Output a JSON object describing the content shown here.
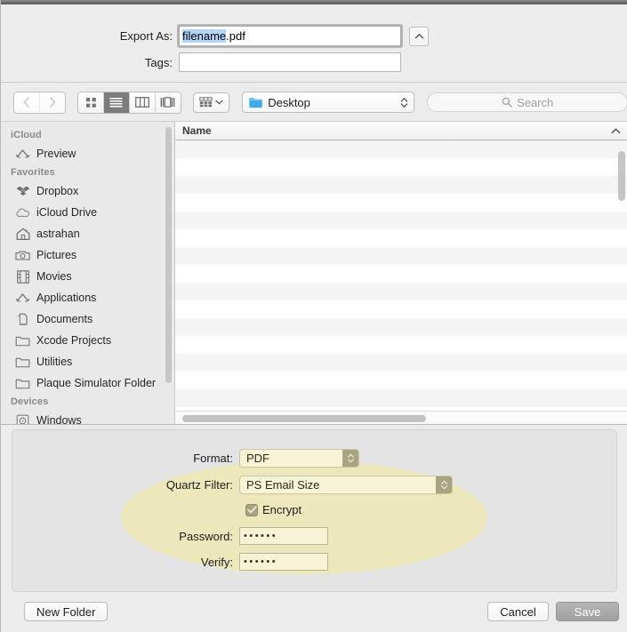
{
  "header": {
    "export_as_label": "Export As:",
    "filename_selected": "filename",
    "filename_extension": ".pdf",
    "tags_label": "Tags:",
    "tags_value": "",
    "disclosure_icon": "chevron-up-icon"
  },
  "toolbar": {
    "back_icon": "chevron-left-icon",
    "forward_icon": "chevron-right-icon",
    "view_icon_grid": "icon-view-icon",
    "view_list": "list-view-icon",
    "view_column": "column-view-icon",
    "view_gallery": "gallery-view-icon",
    "arrange_icon": "arrange-by-icon",
    "arrange_chevron": "chevron-down-icon",
    "location_icon": "folder-icon",
    "location_value": "Desktop",
    "location_stepper_icon": "up-down-chevron-icon",
    "search_icon": "search-icon",
    "search_placeholder": "Search",
    "search_value": ""
  },
  "sidebar": {
    "groups": [
      {
        "title": "iCloud",
        "items": [
          {
            "label": "Preview",
            "icon": "preview-app-icon"
          }
        ]
      },
      {
        "title": "Favorites",
        "items": [
          {
            "label": "Dropbox",
            "icon": "dropbox-icon"
          },
          {
            "label": "iCloud Drive",
            "icon": "cloud-icon"
          },
          {
            "label": "astrahan",
            "icon": "home-icon"
          },
          {
            "label": "Pictures",
            "icon": "camera-icon"
          },
          {
            "label": "Movies",
            "icon": "film-icon"
          },
          {
            "label": "Applications",
            "icon": "applications-icon"
          },
          {
            "label": "Documents",
            "icon": "documents-icon"
          },
          {
            "label": "Xcode Projects",
            "icon": "folder-icon"
          },
          {
            "label": "Utilities",
            "icon": "folder-icon"
          },
          {
            "label": "Plaque Simulator Folder",
            "icon": "folder-icon"
          }
        ]
      },
      {
        "title": "Devices",
        "items": [
          {
            "label": "Windows",
            "icon": "disk-icon"
          }
        ]
      }
    ]
  },
  "filelist": {
    "column_header": "Name",
    "sort_icon": "chevron-up-icon",
    "rows": [],
    "row_count": 16,
    "vertical_scrollbar_icon": "scrollbar-thumb",
    "horizontal_scrollbar_icon": "scrollbar-thumb"
  },
  "options": {
    "format_label": "Format:",
    "format_value": "PDF",
    "quartz_filter_label": "Quartz Filter:",
    "quartz_filter_value": "PS Email Size",
    "encrypt_label": "Encrypt",
    "encrypt_checked": true,
    "check_icon": "checkmark-icon",
    "password_label": "Password:",
    "password_value": "••••••",
    "verify_label": "Verify:",
    "verify_value": "••••••",
    "highlight_color": "#ece8bc"
  },
  "footer": {
    "new_folder_label": "New Folder",
    "cancel_label": "Cancel",
    "save_label": "Save"
  },
  "colors": {
    "window_bg": "#ececec",
    "panel_bg": "#e4e4e4",
    "sidebar_bg": "#e9e9e9",
    "selection_blue": "#b4d5fb",
    "folder_blue": "#5ab4ec",
    "highlight_yellow": "#ece8bc"
  }
}
